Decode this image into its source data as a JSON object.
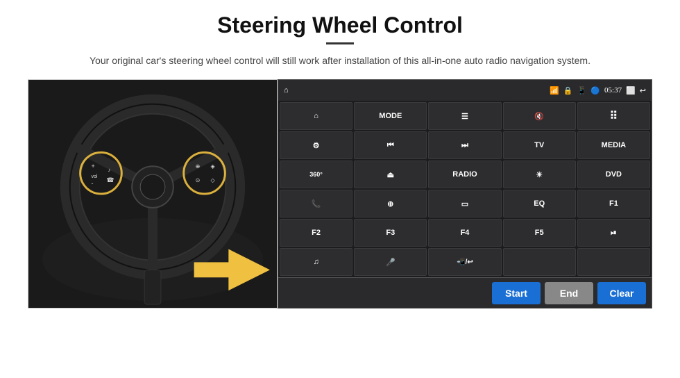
{
  "header": {
    "title": "Steering Wheel Control",
    "subtitle": "Your original car's steering wheel control will still work after installation of this all-in-one auto radio navigation system."
  },
  "status_bar": {
    "time": "05:37",
    "icons": [
      "wifi",
      "lock",
      "sim",
      "bluetooth",
      "back"
    ]
  },
  "buttons": [
    {
      "id": "home",
      "type": "icon",
      "icon": "home",
      "label": "Home"
    },
    {
      "id": "mode",
      "type": "text",
      "label": "MODE"
    },
    {
      "id": "list",
      "type": "icon",
      "icon": "list",
      "label": "List"
    },
    {
      "id": "mute",
      "type": "icon",
      "icon": "mute",
      "label": "Mute"
    },
    {
      "id": "apps",
      "type": "icon",
      "icon": "apps",
      "label": "Apps"
    },
    {
      "id": "settings",
      "type": "icon",
      "icon": "settings",
      "label": "Settings"
    },
    {
      "id": "prev",
      "type": "icon",
      "icon": "prev",
      "label": "Previous"
    },
    {
      "id": "next",
      "type": "icon",
      "icon": "next",
      "label": "Next"
    },
    {
      "id": "tv",
      "type": "text",
      "label": "TV"
    },
    {
      "id": "media",
      "type": "text",
      "label": "MEDIA"
    },
    {
      "id": "cam360",
      "type": "icon",
      "icon": "360",
      "label": "360 Camera"
    },
    {
      "id": "eject",
      "type": "icon",
      "icon": "eject",
      "label": "Eject"
    },
    {
      "id": "radio",
      "type": "text",
      "label": "RADIO"
    },
    {
      "id": "brightness",
      "type": "icon",
      "icon": "brightness",
      "label": "Brightness"
    },
    {
      "id": "dvd",
      "type": "text",
      "label": "DVD"
    },
    {
      "id": "phone",
      "type": "icon",
      "icon": "phone",
      "label": "Phone"
    },
    {
      "id": "explore",
      "type": "icon",
      "icon": "explore",
      "label": "Explore"
    },
    {
      "id": "screen",
      "type": "icon",
      "icon": "screen",
      "label": "Screen"
    },
    {
      "id": "eq",
      "type": "text",
      "label": "EQ"
    },
    {
      "id": "f1",
      "type": "text",
      "label": "F1"
    },
    {
      "id": "f2",
      "type": "text",
      "label": "F2"
    },
    {
      "id": "f3",
      "type": "text",
      "label": "F3"
    },
    {
      "id": "f4",
      "type": "text",
      "label": "F4"
    },
    {
      "id": "f5",
      "type": "text",
      "label": "F5"
    },
    {
      "id": "playpause",
      "type": "icon",
      "icon": "playpause",
      "label": "Play/Pause"
    },
    {
      "id": "music",
      "type": "icon",
      "icon": "music",
      "label": "Music"
    },
    {
      "id": "mic",
      "type": "icon",
      "icon": "mic",
      "label": "Microphone"
    },
    {
      "id": "callhangup",
      "type": "icon",
      "icon": "callhangup",
      "label": "Call/Hang Up"
    }
  ],
  "action_bar": {
    "start_label": "Start",
    "end_label": "End",
    "clear_label": "Clear"
  }
}
